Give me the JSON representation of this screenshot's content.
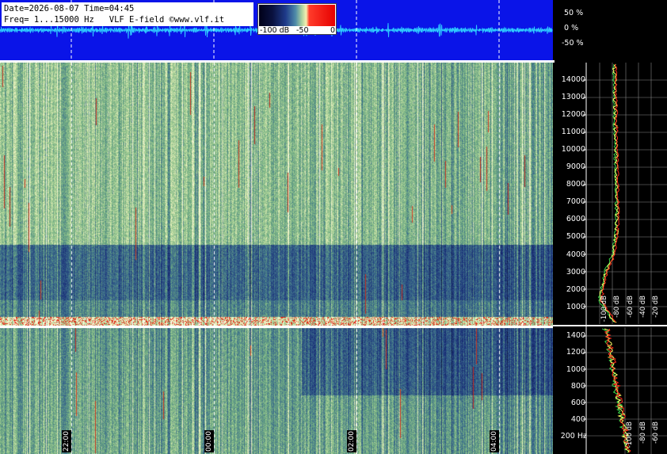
{
  "info": {
    "line1": "Date=2026-08-07 Time=04:45",
    "line2": "Freq= 1...15000 Hz   VLF E-field ©www.vlf.it"
  },
  "colorbar": {
    "labels": [
      "-100 dB",
      "-50",
      "0"
    ]
  },
  "waveform_scale": [
    "50 %",
    "0 %",
    "-50 %"
  ],
  "freq_upper_labels": [
    "14000",
    "13000",
    "12000",
    "11000",
    "10000",
    "9000",
    "8000",
    "7000",
    "6000",
    "5000",
    "4000",
    "3000",
    "2000",
    "1000"
  ],
  "freq_lower_labels": [
    "1400",
    "1200",
    "1000",
    "800",
    "600",
    "400",
    "200 Hz"
  ],
  "time_labels": [
    "22:00",
    "00:00",
    "02:00",
    "04:00"
  ],
  "db_upper_labels": [
    "-100 dB",
    "-80 dB",
    "-60 dB",
    "-40 dB",
    "-20 dB"
  ],
  "db_lower_labels": [
    "-100 dB",
    "-80 dB",
    "-60 dB",
    "-40 dB",
    "-20 dB"
  ],
  "colors": {
    "wave_bg": "#0a14e8",
    "wave_trace": "#2ec8ff",
    "grid_dashed": "#ffffff",
    "spectrum_green": "#39d84a",
    "spectrum_red": "#ff2a1a",
    "spectrum_yellow": "#ffff66"
  }
}
